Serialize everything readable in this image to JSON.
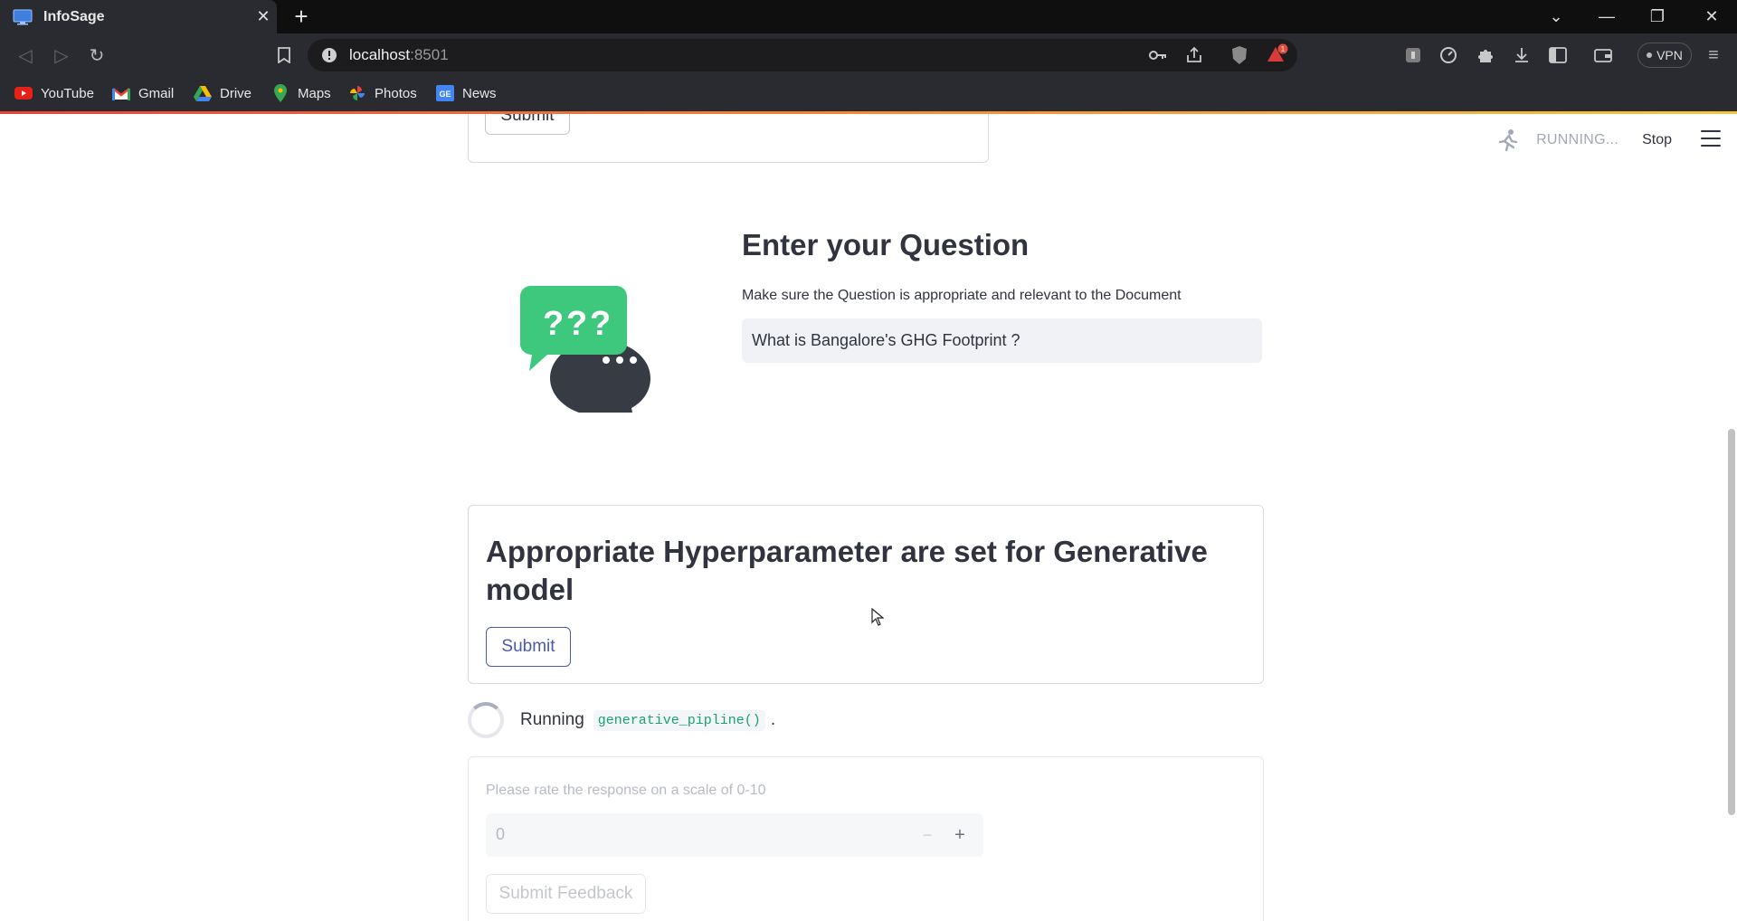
{
  "browser": {
    "tab_title": "InfoSage",
    "new_tab_icon": "plus-icon",
    "url_host": "localhost",
    "url_port": ":8501",
    "vpn_label": "VPN",
    "shields_badge": "1",
    "bookmarks": [
      {
        "label": "YouTube",
        "icon": "youtube-icon"
      },
      {
        "label": "Gmail",
        "icon": "gmail-icon"
      },
      {
        "label": "Drive",
        "icon": "drive-icon"
      },
      {
        "label": "Maps",
        "icon": "maps-icon"
      },
      {
        "label": "Photos",
        "icon": "photos-icon"
      },
      {
        "label": "News",
        "icon": "news-icon"
      }
    ]
  },
  "app": {
    "status_text": "RUNNING...",
    "stop_label": "Stop",
    "prev_form": {
      "submit_label": "Submit"
    },
    "question": {
      "heading": "Enter your Question",
      "label": "Make sure the Question is appropriate and relevant to the Document",
      "value": "What is Bangalore's GHG Footprint ?"
    },
    "hyperparams": {
      "heading": "Appropriate Hyperparameter are set for Generative model",
      "submit_label": "Submit"
    },
    "running": {
      "word": "Running",
      "code": "generative_pipline()",
      "dot": "."
    },
    "feedback": {
      "label": "Please rate the response on a scale of 0-10",
      "value": "0",
      "minus": "−",
      "plus": "+",
      "submit_label": "Submit Feedback"
    }
  },
  "colors": {
    "text": "#31333f",
    "primary_outline": "#4b5aa6",
    "code_green": "#17a36b",
    "input_bg": "#f0f2f6",
    "chrome_bg": "#2a2b30"
  }
}
